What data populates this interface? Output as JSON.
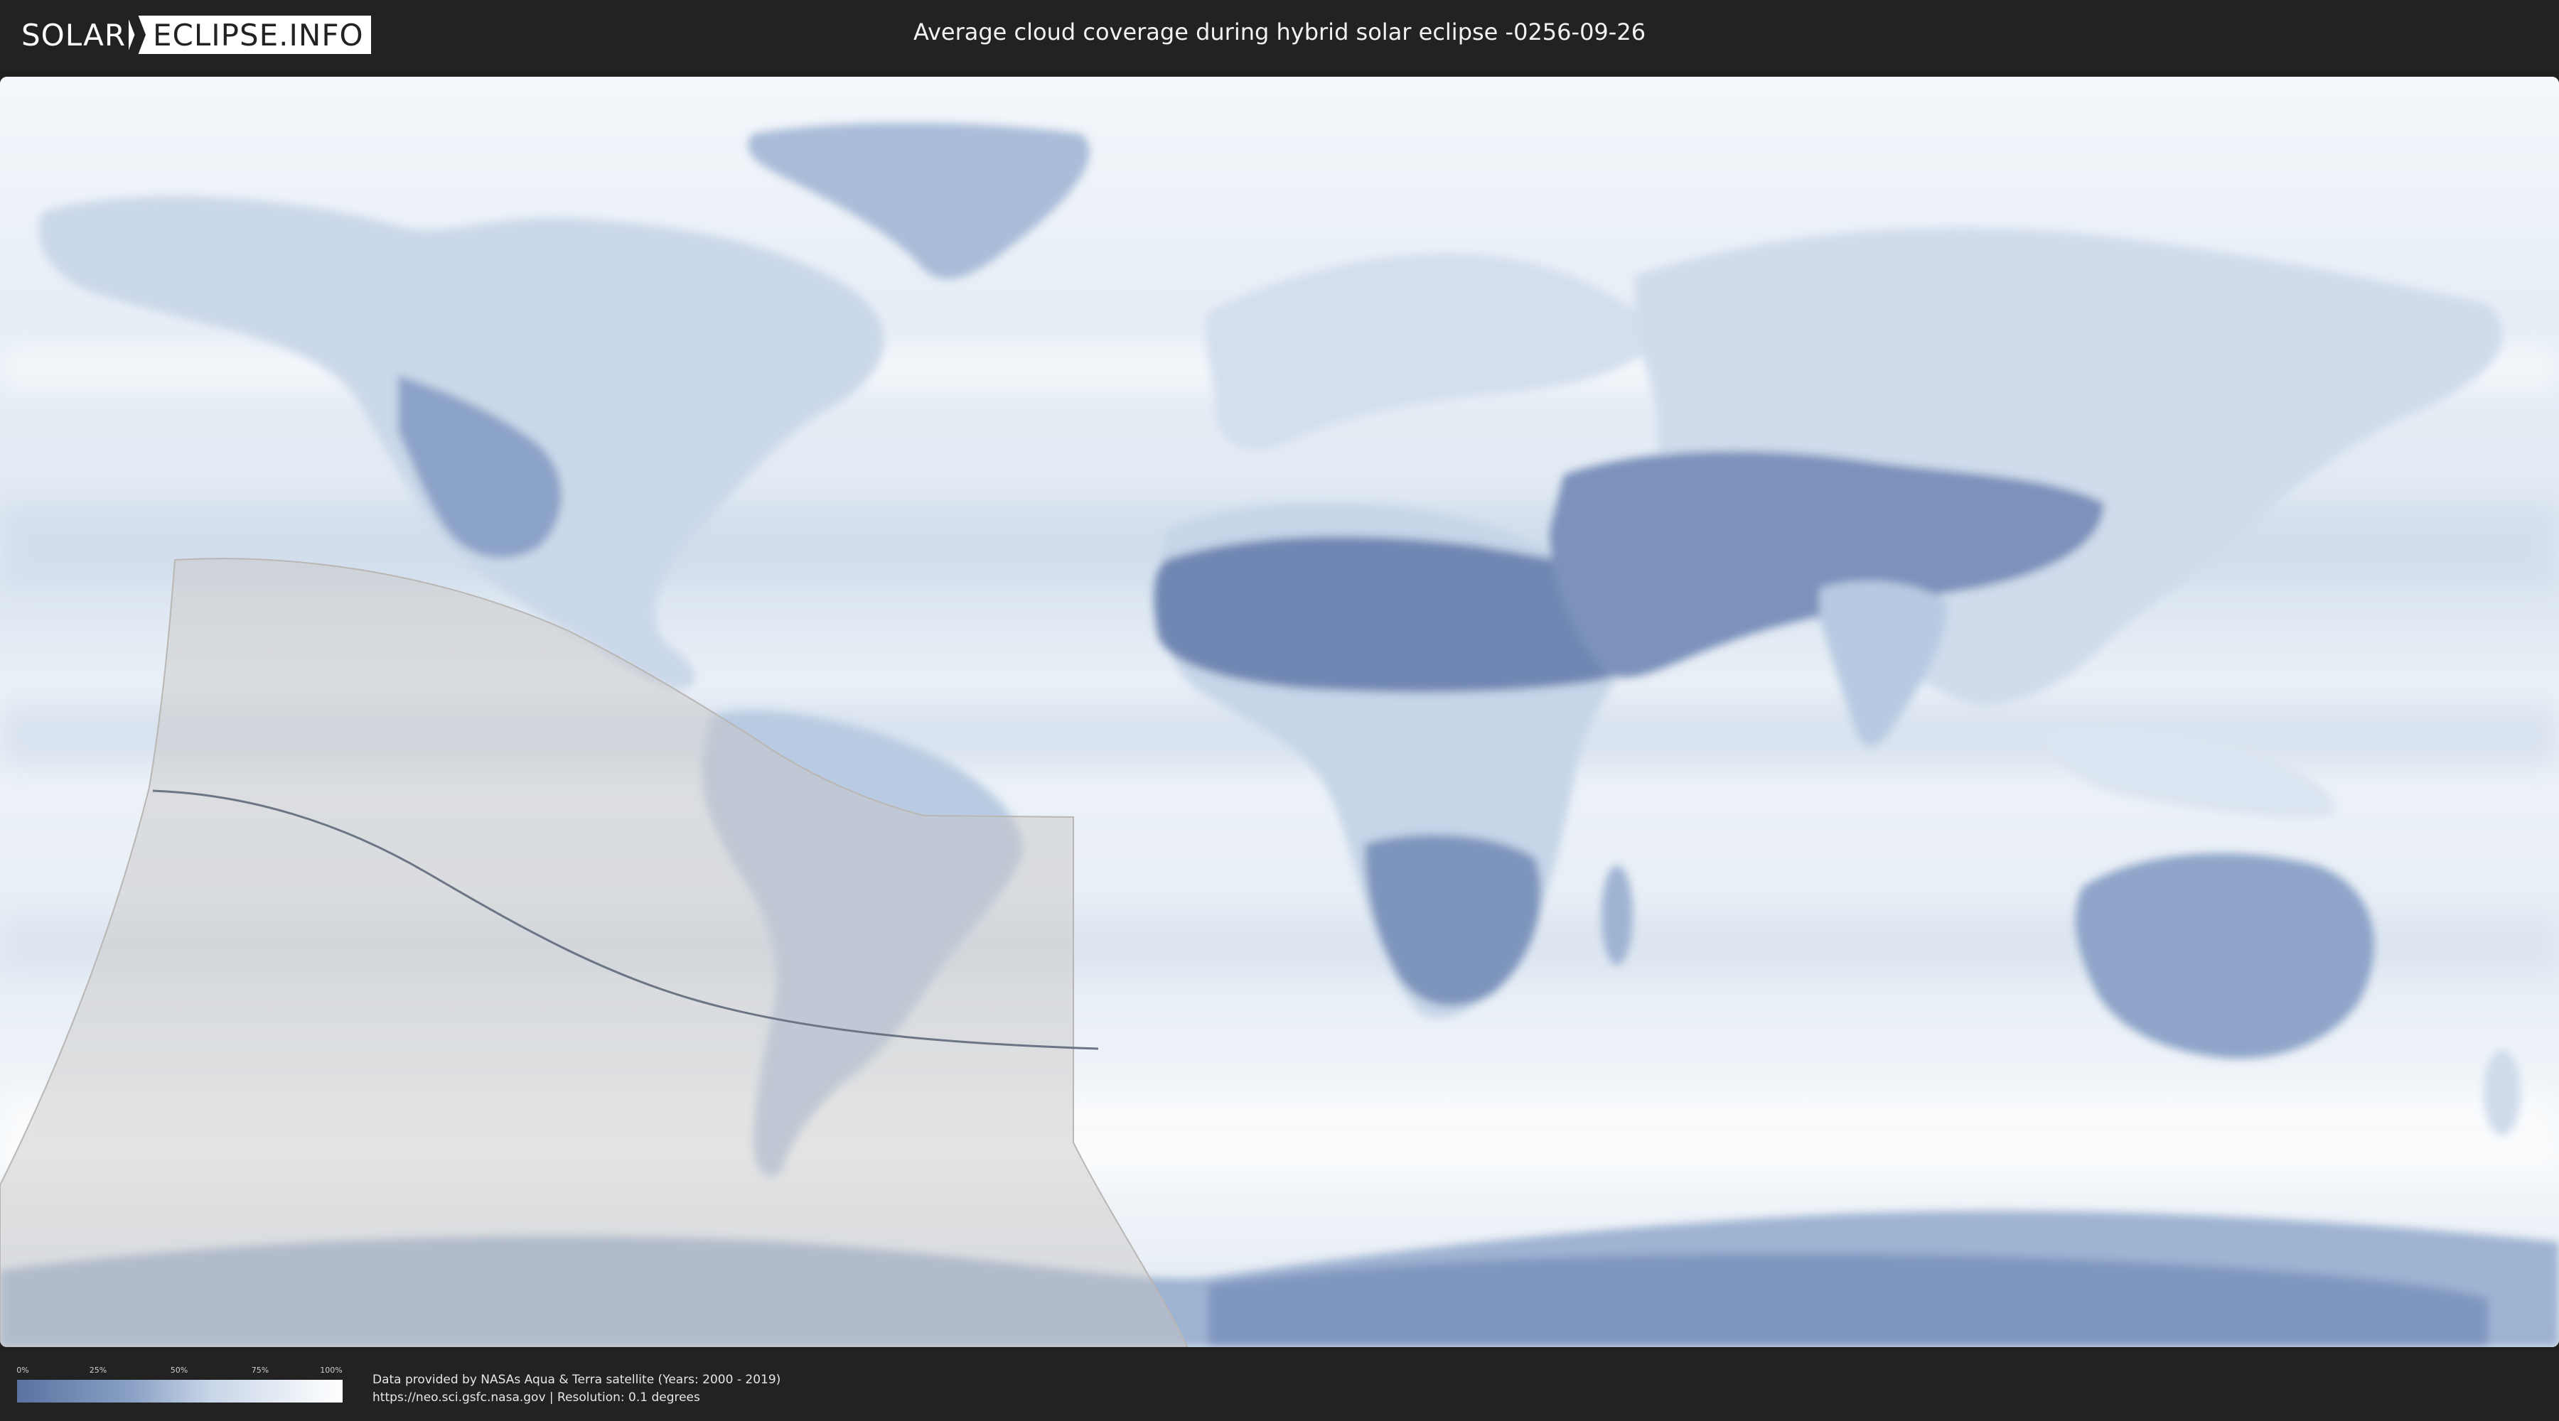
{
  "header": {
    "logo_left": "SOLAR",
    "logo_right": "ECLIPSE.INFO",
    "title": "Average cloud coverage during hybrid solar eclipse -0256-09-26"
  },
  "legend": {
    "ticks": [
      "0%",
      "25%",
      "50%",
      "75%",
      "100%"
    ],
    "low_color": "#5a72a0",
    "high_color": "#ffffff"
  },
  "credits": {
    "line1": "Data provided by NASAs Aqua & Terra satellite (Years: 2000 - 2019)",
    "line2": "https://neo.sci.gsfc.nasa.gov | Resolution: 0.1 degrees"
  },
  "colors": {
    "background": "#202020",
    "ocean": "#e9f0f7",
    "clear_sky": "#6d86b3",
    "eclipse_overlay": "#c8c6c4"
  }
}
